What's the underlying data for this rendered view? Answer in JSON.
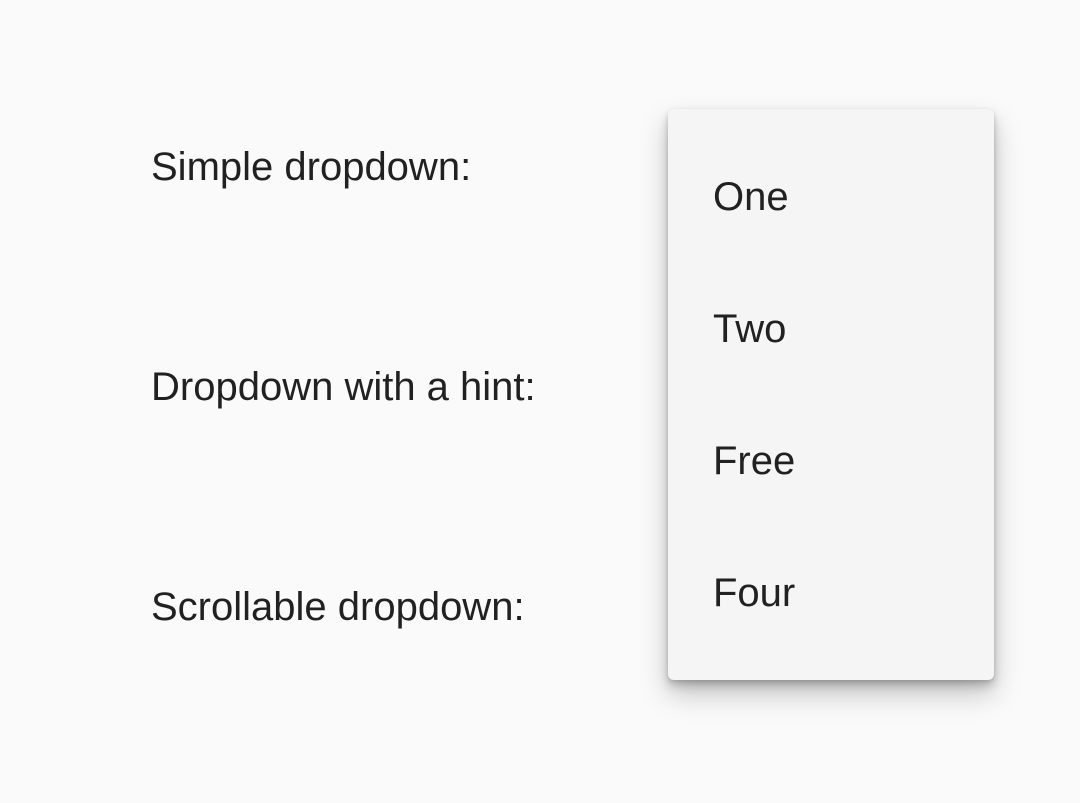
{
  "labels": {
    "simple": "Simple dropdown:",
    "hint": "Dropdown with a hint:",
    "scrollable": "Scrollable dropdown:"
  },
  "dropdown_menu": {
    "items": [
      {
        "label": "One"
      },
      {
        "label": "Two"
      },
      {
        "label": "Free"
      },
      {
        "label": "Four"
      }
    ]
  },
  "colors": {
    "background": "#fafafa",
    "menu_surface": "#f5f5f5",
    "text": "#212121"
  }
}
